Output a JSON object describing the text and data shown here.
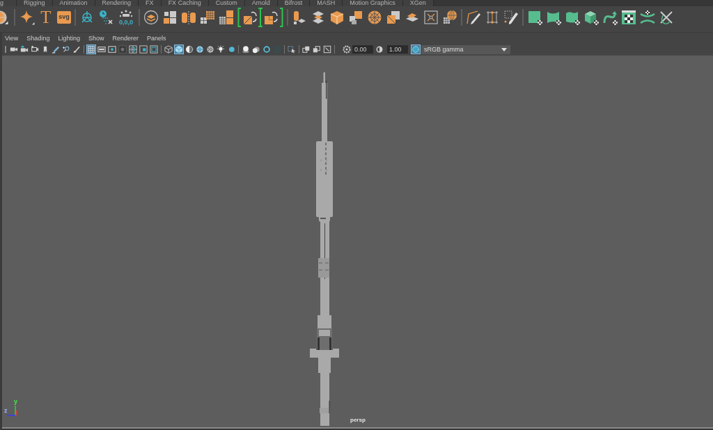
{
  "shelf": {
    "tabs": [
      {
        "label": "g"
      },
      {
        "label": "Rigging"
      },
      {
        "label": "Animation"
      },
      {
        "label": "Rendering"
      },
      {
        "label": "FX"
      },
      {
        "label": "FX Caching"
      },
      {
        "label": "Custom"
      },
      {
        "label": "Arnold"
      },
      {
        "label": "Bifrost"
      },
      {
        "label": "MASH"
      },
      {
        "label": "Motion Graphics"
      },
      {
        "label": "XGen"
      }
    ],
    "text_button": "T",
    "svg_button": "svg",
    "origin_button": "0,0,0"
  },
  "panel": {
    "menu": [
      "View",
      "Shading",
      "Lighting",
      "Show",
      "Renderer",
      "Panels"
    ],
    "toolbar": {
      "button_groups": [
        [
          {
            "on": false
          },
          {
            "on": false
          },
          {
            "on": false
          },
          {
            "on": false
          },
          {
            "on": false
          },
          {
            "on": false
          },
          {
            "on": false
          }
        ],
        [
          {
            "on": true
          },
          {
            "on": false
          },
          {
            "on": false
          },
          {
            "on": false
          },
          {
            "on": false
          },
          {
            "on": false
          },
          {
            "on": false
          }
        ],
        [
          {
            "on": false
          },
          {
            "on": true
          },
          {
            "on": false
          },
          {
            "on": false
          },
          {
            "on": false
          },
          {
            "on": false
          },
          {
            "on": false
          }
        ],
        [
          {
            "on": false
          },
          {
            "on": false
          },
          {
            "on": false
          },
          {
            "on": false
          }
        ],
        [
          {
            "on": false
          }
        ],
        [
          {
            "on": false
          },
          {
            "on": false
          },
          {
            "on": false
          }
        ]
      ],
      "exposure": "0.00",
      "gamma": "1.00",
      "color_management_on": true,
      "view_transform": "sRGB gamma"
    },
    "viewport": {
      "camera": "persp",
      "axis_labels": [
        "y",
        "z"
      ]
    }
  }
}
